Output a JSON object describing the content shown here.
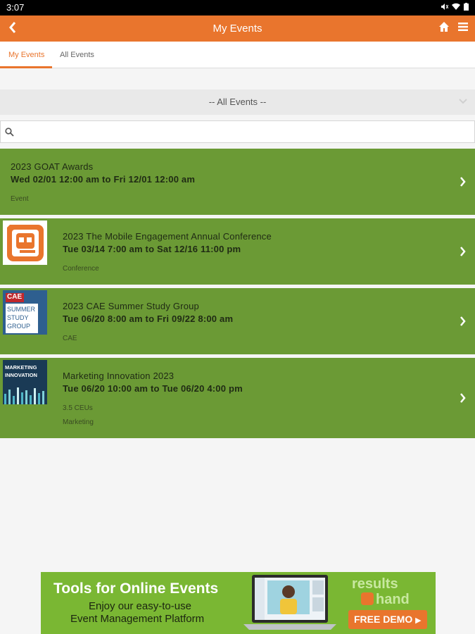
{
  "status": {
    "time": "3:07"
  },
  "header": {
    "title": "My Events"
  },
  "tabs": [
    {
      "label": "My Events"
    },
    {
      "label": "All Events"
    }
  ],
  "filter": {
    "selected": "-- All Events --"
  },
  "search": {
    "placeholder": "",
    "value": ""
  },
  "events": [
    {
      "title": "2023 GOAT Awards",
      "dates": "Wed 02/01 12:00 am to Fri 12/01 12:00 am",
      "category": "Event"
    },
    {
      "title": "2023 The Mobile Engagement Annual Conference",
      "dates": "Tue 03/14 7:00 am to Sat 12/16 11:00 pm",
      "category": "Conference"
    },
    {
      "title": "2023 CAE Summer Study Group",
      "dates": "Tue 06/20 8:00 am to Fri 09/22 8:00 am",
      "category": "CAE",
      "thumb_text": [
        "CAE",
        "SUMMER",
        "STUDY",
        "GROUP"
      ]
    },
    {
      "title": "Marketing Innovation 2023",
      "dates": "Tue 06/20 10:00 am to Tue 06/20 4:00 pm",
      "ceus": "3.5 CEUs",
      "category": "Marketing",
      "thumb_text": [
        "MARKETING",
        "INNOVATION"
      ]
    }
  ],
  "banner": {
    "headline": "Tools for Online Events",
    "line1": "Enjoy our easy-to-use",
    "line2": "Event Management Platform",
    "brand_line1": "results",
    "brand_line2": "hand",
    "cta": "FREE DEMO"
  },
  "colors": {
    "accent": "#e9752d",
    "card": "#6b9a35"
  }
}
